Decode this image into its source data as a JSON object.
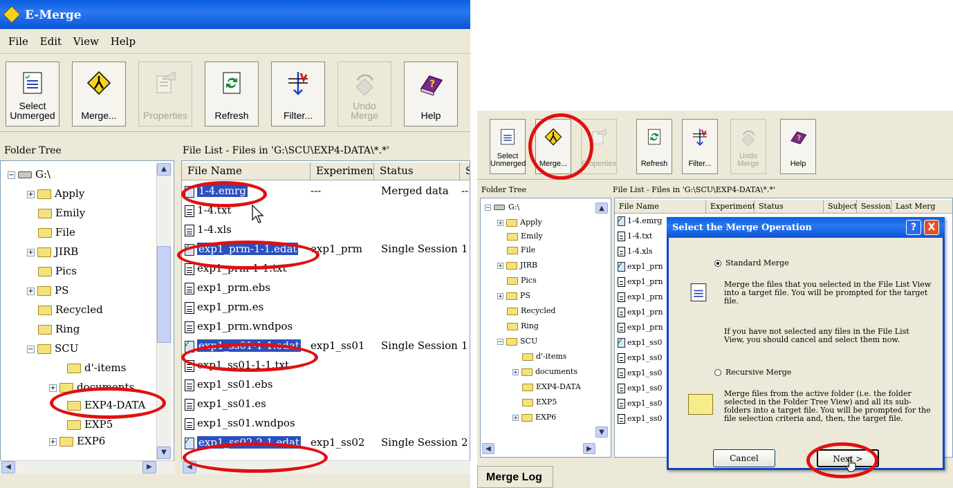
{
  "left_window": {
    "title": "E-Merge",
    "menu": [
      "File",
      "Edit",
      "View",
      "Help"
    ],
    "toolbar": [
      {
        "label_line1": "Select",
        "label_line2": "Unmerged",
        "icon": "select-unmerged-icon",
        "enabled": true
      },
      {
        "label_line1": "",
        "label_line2": "Merge...",
        "icon": "merge-icon",
        "enabled": true
      },
      {
        "label_line1": "",
        "label_line2": "Properties",
        "icon": "properties-icon",
        "enabled": false
      },
      {
        "label_line1": "",
        "label_line2": "Refresh",
        "icon": "refresh-icon",
        "enabled": true
      },
      {
        "label_line1": "",
        "label_line2": "Filter...",
        "icon": "filter-icon",
        "enabled": true
      },
      {
        "label_line1": "Undo",
        "label_line2": "Merge",
        "icon": "undo-merge-icon",
        "enabled": false
      },
      {
        "label_line1": "",
        "label_line2": "Help",
        "icon": "help-book-icon",
        "enabled": true
      }
    ],
    "folder_tree_header": "Folder Tree",
    "file_list_header": "File List - Files in 'G:\\SCU\\EXP4-DATA\\*.*'",
    "tree": [
      {
        "label": "G:\\",
        "expander": "−"
      },
      {
        "label": "Apply",
        "expander": "+"
      },
      {
        "label": "Emily",
        "expander": ""
      },
      {
        "label": "File",
        "expander": ""
      },
      {
        "label": "JIRB",
        "expander": "+"
      },
      {
        "label": "Pics",
        "expander": ""
      },
      {
        "label": "PS",
        "expander": "+"
      },
      {
        "label": "Recycled",
        "expander": ""
      },
      {
        "label": "Ring",
        "expander": ""
      },
      {
        "label": "SCU",
        "expander": "−"
      },
      {
        "label": "d'-items",
        "expander": ""
      },
      {
        "label": "documents",
        "expander": "+"
      },
      {
        "label": "EXP4-DATA",
        "expander": ""
      },
      {
        "label": "EXP5",
        "expander": ""
      },
      {
        "label": "EXP6",
        "expander": "+"
      }
    ],
    "columns": [
      "File Name",
      "Experiment",
      "Status",
      "S"
    ],
    "files": [
      {
        "name": "1-4.emrg",
        "experiment": "---",
        "status": "Merged data",
        "s": "--",
        "type": "data",
        "selected": true
      },
      {
        "name": "1-4.txt",
        "experiment": "",
        "status": "",
        "s": "",
        "type": "file",
        "selected": false
      },
      {
        "name": "1-4.xls",
        "experiment": "",
        "status": "",
        "s": "",
        "type": "file",
        "selected": false
      },
      {
        "name": "exp1_prm-1-1.edat",
        "experiment": "exp1_prm",
        "status": "Single Session",
        "s": "1",
        "type": "data",
        "selected": true
      },
      {
        "name": "exp1_prm-1-1.txt",
        "experiment": "",
        "status": "",
        "s": "",
        "type": "file",
        "selected": false
      },
      {
        "name": "exp1_prm.ebs",
        "experiment": "",
        "status": "",
        "s": "",
        "type": "file",
        "selected": false
      },
      {
        "name": "exp1_prm.es",
        "experiment": "",
        "status": "",
        "s": "",
        "type": "file",
        "selected": false
      },
      {
        "name": "exp1_prm.wndpos",
        "experiment": "",
        "status": "",
        "s": "",
        "type": "file",
        "selected": false
      },
      {
        "name": "exp1_ss01-1-1.edat",
        "experiment": "exp1_ss01",
        "status": "Single Session",
        "s": "1",
        "type": "data",
        "selected": true
      },
      {
        "name": "exp1_ss01-1-1.txt",
        "experiment": "",
        "status": "",
        "s": "",
        "type": "file",
        "selected": false
      },
      {
        "name": "exp1_ss01.ebs",
        "experiment": "",
        "status": "",
        "s": "",
        "type": "file",
        "selected": false
      },
      {
        "name": "exp1_ss01.es",
        "experiment": "",
        "status": "",
        "s": "",
        "type": "file",
        "selected": false
      },
      {
        "name": "exp1_ss01.wndpos",
        "experiment": "",
        "status": "",
        "s": "",
        "type": "file",
        "selected": false
      },
      {
        "name": "exp1_ss02-2-1.edat",
        "experiment": "exp1_ss02",
        "status": "Single Session",
        "s": "2",
        "type": "data",
        "selected": true
      }
    ]
  },
  "right_window": {
    "toolbar": [
      {
        "label_line1": "Select",
        "label_line2": "Unmerged",
        "enabled": true
      },
      {
        "label_line1": "",
        "label_line2": "Merge...",
        "enabled": true
      },
      {
        "label_line1": "",
        "label_line2": "Properties",
        "enabled": false
      },
      {
        "label_line1": "",
        "label_line2": "Refresh",
        "enabled": true
      },
      {
        "label_line1": "",
        "label_line2": "Filter...",
        "enabled": true
      },
      {
        "label_line1": "Undo",
        "label_line2": "Merge",
        "enabled": false
      },
      {
        "label_line1": "",
        "label_line2": "Help",
        "enabled": true
      }
    ],
    "folder_tree_header": "Folder Tree",
    "file_list_header": "File List - Files in 'G:\\SCU\\EXP4-DATA\\*.*'",
    "tree": [
      {
        "label": "G:\\",
        "expander": "−"
      },
      {
        "label": "Apply",
        "expander": "+"
      },
      {
        "label": "Emily",
        "expander": ""
      },
      {
        "label": "File",
        "expander": ""
      },
      {
        "label": "JIRB",
        "expander": "+"
      },
      {
        "label": "Pics",
        "expander": ""
      },
      {
        "label": "PS",
        "expander": "+"
      },
      {
        "label": "Recycled",
        "expander": ""
      },
      {
        "label": "Ring",
        "expander": ""
      },
      {
        "label": "SCU",
        "expander": "−"
      },
      {
        "label": "d'-items",
        "expander": ""
      },
      {
        "label": "documents",
        "expander": "+"
      },
      {
        "label": "EXP4-DATA",
        "expander": ""
      },
      {
        "label": "EXP5",
        "expander": ""
      },
      {
        "label": "EXP6",
        "expander": "+"
      }
    ],
    "columns": [
      "File Name",
      "Experiment",
      "Status",
      "Subject",
      "Session",
      "Last Merg"
    ],
    "files": [
      {
        "name": "1-4.emrg",
        "type": "data"
      },
      {
        "name": "1-4.txt",
        "type": "file"
      },
      {
        "name": "1-4.xls",
        "type": "file"
      },
      {
        "name": "exp1_prn",
        "type": "data"
      },
      {
        "name": "exp1_prn",
        "type": "file"
      },
      {
        "name": "exp1_prn",
        "type": "file"
      },
      {
        "name": "exp1_prn",
        "type": "file"
      },
      {
        "name": "exp1_prn",
        "type": "file"
      },
      {
        "name": "exp1_ss0",
        "type": "data"
      },
      {
        "name": "exp1_ss0",
        "type": "file"
      },
      {
        "name": "exp1_ss0",
        "type": "file"
      },
      {
        "name": "exp1_ss0",
        "type": "file"
      },
      {
        "name": "exp1_ss0",
        "type": "file"
      },
      {
        "name": "exp1_ss0",
        "type": "file"
      }
    ],
    "merge_log_tab": "Merge Log"
  },
  "dialog": {
    "title": "Select the Merge Operation",
    "help_button": "?",
    "close_button": "X",
    "standard_label": "Standard Merge",
    "standard_selected": true,
    "standard_desc": "Merge the files that you selected in the File List View into a target file. You will be prompted for the target file.",
    "standard_note": "If you have not selected any files in the File List View, you should cancel and select them now.",
    "recursive_label": "Recursive Merge",
    "recursive_selected": false,
    "recursive_desc": "Merge files from the active folder (i.e. the folder selected in the Folder Tree View) and all its sub-folders into a target file. You will be prompted for the file selection criteria and, then, the target file.",
    "cancel_label": "Cancel",
    "next_label": "Next >"
  },
  "colors": {
    "highlight": "#e01010",
    "selection": "#2b4fbf",
    "titlebar": "#0a5ee0",
    "window_bg": "#ece9d8"
  }
}
